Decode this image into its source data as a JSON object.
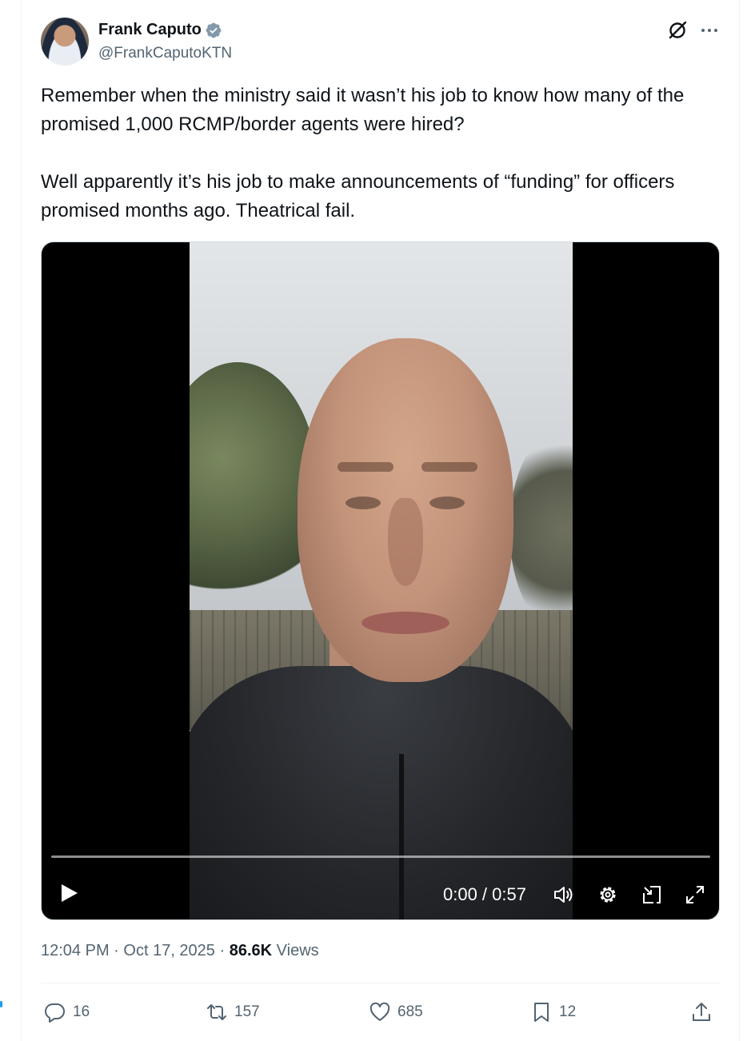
{
  "author": {
    "name": "Frank Caputo",
    "handle": "@FrankCaputoKTN",
    "verified": true
  },
  "tweet": {
    "paragraphs": [
      "Remember when the ministry said it wasn’t his job to know how many of the promised 1,000 RCMP/border agents were hired?",
      "Well apparently it’s his job to make announcements of “funding” for officers promised months ago. Theatrical fail."
    ]
  },
  "video": {
    "time_display": "0:00 / 0:57",
    "progress": 0.0
  },
  "meta": {
    "time": "12:04 PM",
    "date": "Oct 17, 2025",
    "separator": "·",
    "views_count": "86.6K",
    "views_label": "Views"
  },
  "actions": {
    "replies": "16",
    "reposts": "157",
    "likes": "685",
    "bookmarks": "12"
  },
  "colors": {
    "accent": "#1d9bf0",
    "secondary_text": "#536471",
    "primary_text": "#0f1419"
  }
}
